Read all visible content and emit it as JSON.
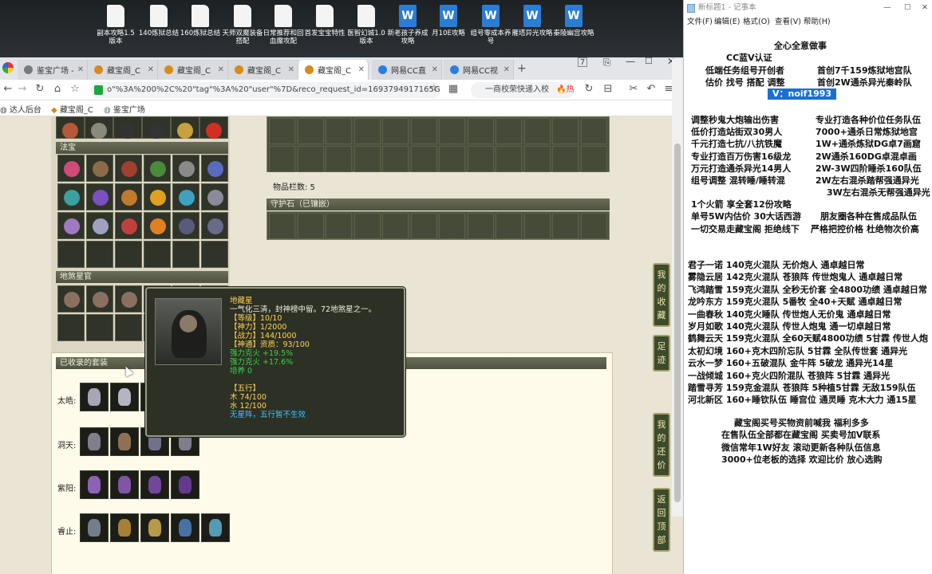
{
  "desktop": {
    "icons": [
      {
        "label": "副本攻略1.5版本",
        "type": "file"
      },
      {
        "label": "140炼狱总结",
        "type": "file"
      },
      {
        "label": "160炼狱总结",
        "type": "file"
      },
      {
        "label": "天师双魔装备搭配",
        "type": "file"
      },
      {
        "label": "日常推荐和回血魔攻配",
        "type": "file"
      },
      {
        "label": "首发宝宝特性",
        "type": "file"
      },
      {
        "label": "医智幻城1.0版本",
        "type": "file"
      },
      {
        "label": "新老孩子养成攻略",
        "type": "word"
      },
      {
        "label": "月10E攻略",
        "type": "word"
      },
      {
        "label": "组号零成本养号",
        "type": "word"
      },
      {
        "label": "雁塔异光攻略",
        "type": "word"
      },
      {
        "label": "秦陵幽宫攻略",
        "type": "word"
      }
    ]
  },
  "browser": {
    "tabs": [
      {
        "label": "鉴宝广场 - ",
        "color": "#7a7a7a"
      },
      {
        "label": "藏宝阁_C",
        "color": "#d88a1a"
      },
      {
        "label": "藏宝阁_C",
        "color": "#d88a1a"
      },
      {
        "label": "藏宝阁_C",
        "color": "#d88a1a"
      },
      {
        "label": "藏宝阁_C",
        "color": "#d88a1a"
      },
      {
        "label": "网易CC直",
        "color": "#2a7ee0"
      },
      {
        "label": "网易CC视",
        "color": "#2a7ee0"
      }
    ],
    "url": "o\"%3A%200%2C%20\"tag\"%3A%20\"user\"%7D&reco_request_id=1693794917165GeKrf",
    "search_text": "一商校荣快递入校",
    "hot_label": "热搜",
    "bookmarks": [
      "达人后台",
      "藏宝阁_C",
      "鉴宝广场"
    ]
  },
  "game": {
    "sections": {
      "fabao": "法宝",
      "disha": "地煞星官",
      "collected": "已收录的套装",
      "guardian": "守护石（已镶嵌）"
    },
    "items_count_label": "物品栏数: 5",
    "rows": [
      {
        "label": "太皓:"
      },
      {
        "label": "洞天:"
      },
      {
        "label": "紫阳:"
      },
      {
        "label": "睿止:"
      }
    ],
    "side_buttons": [
      "我的收藏",
      "足迹",
      "我的还价",
      "返回顶部"
    ]
  },
  "tooltip": {
    "name": "地藏星",
    "desc": "一气化三清，封神榜中留。72地煞星之一。",
    "level": "【等级】10/10",
    "power": "【神力】1/2000",
    "combat": "【战力】144/1000",
    "aptitude": "【神通】资质：93/100",
    "bonus1": "强力克火 +19.5%",
    "bonus2": "强力克火 +17.6%",
    "train": "培养 0",
    "wuxing_title": "【五行】",
    "wood": "木 74/100",
    "water": "水 12/100",
    "note": "无星阵，五行暂不生效"
  },
  "notepad": {
    "title": "新标题1 - 记事本",
    "menu": [
      "文件(F)",
      "编辑(E)",
      "格式(O)",
      "查看(V)",
      "帮助(H)"
    ],
    "header": [
      "全心全意做事",
      "CC蓝V认证",
      "低端任务组号开创者",
      "首创7千159炼狱地宫队",
      "估价 找号 搭配 调整",
      "首创2W通杀异光秦岭队"
    ],
    "vid": "V：noif1993",
    "services": [
      [
        "调整秒鬼大炮输出伤害",
        "专业打造各种价位任务队伍"
      ],
      [
        "低价打造站街双30男人",
        "7000+通杀日常炼狱地宫"
      ],
      [
        "千元打造七抗/八抗铁魔",
        "1W+通杀炼狱DG卓7画窟"
      ],
      [
        "专业打造百万伤害16级龙",
        "2W通杀160DG卓混卓画"
      ],
      [
        "万元打造通杀异光14男人",
        "2W-3W四阶睡杀160队伍"
      ],
      [
        "组号调整 混转睡/睡转混",
        "2W左右混杀踏帮强通异光"
      ],
      [
        "",
        "3W左右混杀无帮强通异光"
      ]
    ],
    "extra": [
      [
        "1个火箭 享全套12份攻略",
        ""
      ],
      [
        "单号5W内估价 30大话西游",
        "朋友圈各种在售成品队伍"
      ],
      [
        "一切交易走藏宝阁 拒绝线下",
        "严格把控价格 杜绝物次价高"
      ]
    ],
    "teams": [
      "君子一诺 140克火混队 无价炮人 通卓越日常",
      "雾隐云居 142克火混队 苍狼阵 传世炮鬼人 通卓越日常",
      "飞鸿踏雪 159克火混队 全秒无价套 全4800功绩 通卓越日常",
      "龙吟东方 159克火混队 5番牧 全40+天赋 通卓越日常",
      "一曲春秋 140克火睡队 传世炮人无价鬼 通卓越日常",
      "岁月如歌 140克火混队 传世人炮鬼 通一切卓越日常",
      "鹤舞云天 159克火混队 全60天赋4800功绩 5甘霖 传世人炮",
      "太初幻境 160+克木四阶忘队 5甘霖 全队传世套 通异光",
      "云水一梦 160+五破混队 金牛阵 5破龙 通异光14星",
      "一战倾城 160+克火四阶混队 苍狼阵 5甘霖 通异光",
      "踏雪寻芳 159克金混队 苍狼阵 5种植5甘霖 无敌159队伍",
      "河北新区 160+睡钦队伍 睡宫位 通灵睡 克木大力 通15星"
    ],
    "footer": [
      "藏宝阁买号买物资前喊我 福利多多",
      "在售队伍全部都在藏宝阁 买卖号加V联系",
      "微信常年1W好友 滚动更新各种队伍信息",
      "3000+位老板的选择 欢迎比价 放心选购"
    ]
  }
}
